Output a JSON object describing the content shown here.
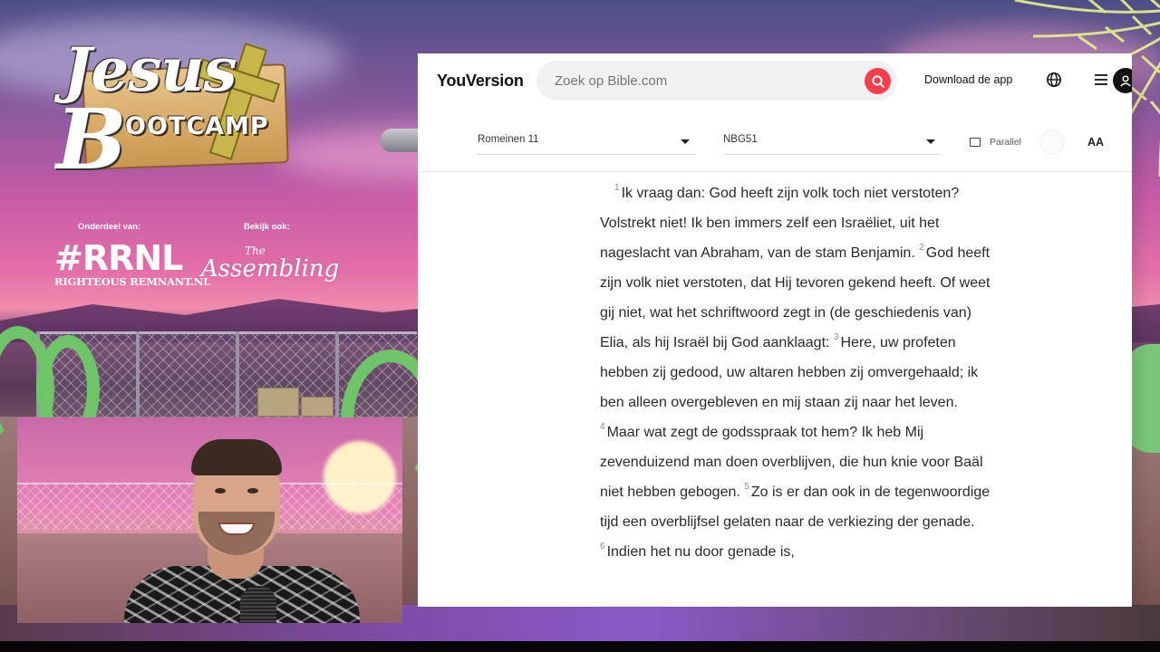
{
  "stream": {
    "logo": {
      "script_text": "Jesus",
      "camp_initial": "B",
      "camp_text": "OOTCAMP"
    },
    "sponsors": {
      "part_of_label": "Onderdeel van:",
      "see_also_label": "Bekijk ook:",
      "rrnl_text": "#RRNL",
      "rrnl_subtext": "RIGHTEOUS REMNANT.NL",
      "assembling_the": "The",
      "assembling_word": "Assembling"
    }
  },
  "youversion": {
    "brand": "YouVersion",
    "search": {
      "placeholder": "Zoek op Bible.com"
    },
    "download_label": "Download de app",
    "icons": {
      "search": "search-icon",
      "globe": "globe-icon",
      "menu": "hamburger-menu-icon",
      "avatar": "user-avatar-icon",
      "parallel": "parallel-view-icon"
    },
    "toolbar": {
      "chapter": "Romeinen 11",
      "version": "NBG51",
      "parallel_label": "Parallel",
      "font_size_label": "AA"
    },
    "verses": [
      {
        "n": "1",
        "text": "Ik vraag dan: God heeft zijn volk toch niet verstoten? Volstrekt niet! Ik ben immers zelf een Israëliet, uit het nageslacht van Abraham, van de stam Benjamin."
      },
      {
        "n": "2",
        "text": "God heeft zijn volk niet verstoten, dat Hij tevoren gekend heeft. Of weet gij niet, wat het schriftwoord zegt in (de geschiedenis van) Elia, als hij Israël bij God aanklaagt:"
      },
      {
        "n": "3",
        "text": "Here, uw profeten hebben zij gedood, uw altaren hebben zij omvergehaald; ik ben alleen overgebleven en mij staan zij naar het leven."
      },
      {
        "n": "4",
        "text": "Maar wat zegt de godsspraak tot hem? Ik heb Mij zevenduizend man doen overblijven, die hun knie voor Baäl niet hebben gebogen."
      },
      {
        "n": "5",
        "text": "Zo is er dan ook in de tegenwoordige tijd een overblijfsel gelaten naar de verkiezing der genade."
      },
      {
        "n": "6",
        "text": "Indien het nu door genade is,"
      }
    ]
  },
  "colors": {
    "search_button": "#ff3d4d",
    "hoop_green": "#6fc46a"
  }
}
